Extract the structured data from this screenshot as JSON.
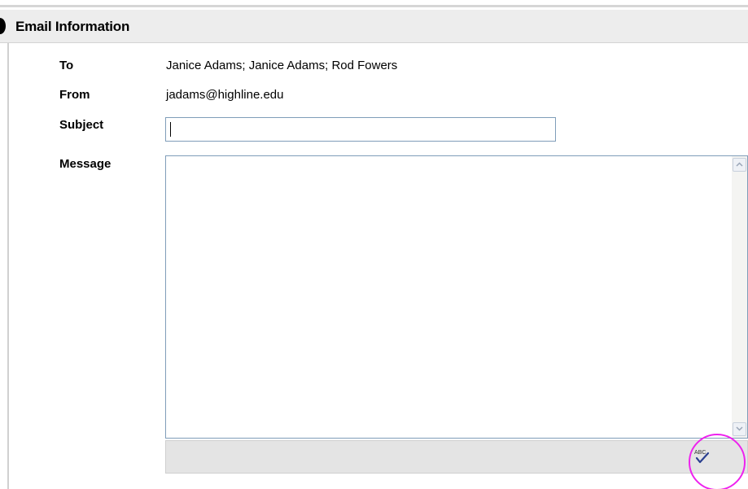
{
  "section": {
    "title": "Email Information"
  },
  "fields": {
    "to_label": "To",
    "to_value": "Janice Adams; Janice Adams; Rod Fowers",
    "from_label": "From",
    "from_value": "jadams@highline.edu",
    "subject_label": "Subject",
    "subject_value": "",
    "message_label": "Message",
    "message_value": ""
  },
  "toolbar": {
    "spellcheck_icon": "spellcheck-abc-icon",
    "spellcheck_text": "ABC"
  },
  "colors": {
    "highlight": "#ee22ee",
    "input_border": "#7f9db9"
  }
}
